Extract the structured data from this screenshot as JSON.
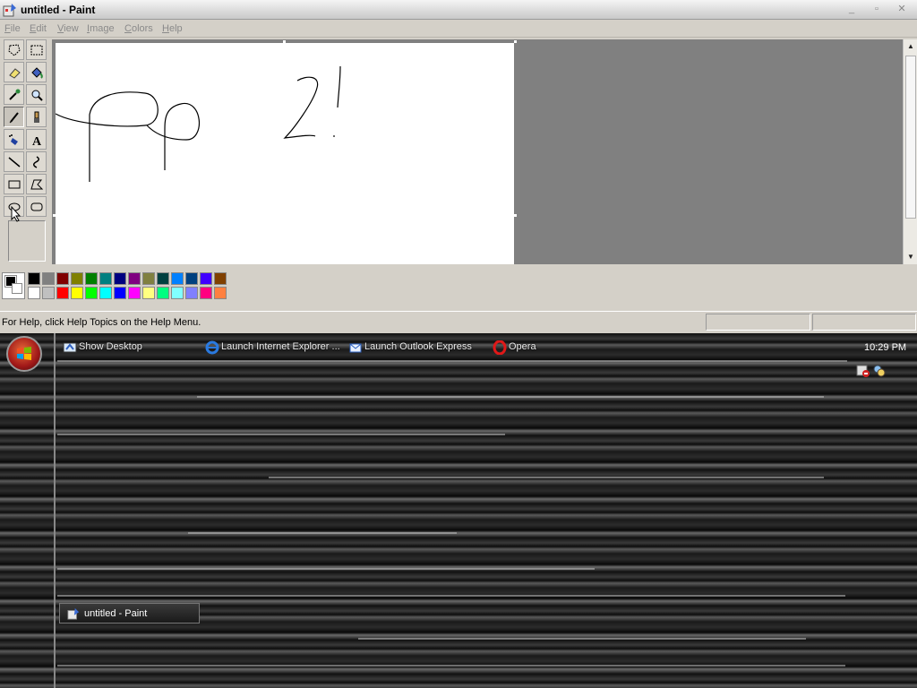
{
  "window": {
    "title": "untitled - Paint",
    "controls": {
      "minimize": "_",
      "maximize": "▫",
      "close": "✕"
    }
  },
  "menu": [
    {
      "first": "F",
      "rest": "ile"
    },
    {
      "first": "E",
      "rest": "dit"
    },
    {
      "first": "V",
      "rest": "iew"
    },
    {
      "first": "I",
      "rest": "mage"
    },
    {
      "first": "C",
      "rest": "olors"
    },
    {
      "first": "H",
      "rest": "elp"
    }
  ],
  "tools": [
    "free-form-select",
    "select",
    "eraser",
    "fill-with-color",
    "pick-color",
    "magnifier",
    "pencil",
    "brush",
    "airbrush",
    "text",
    "line",
    "curve",
    "rectangle",
    "polygon",
    "ellipse",
    "rounded-rectangle"
  ],
  "active_tool": "pencil",
  "palette": {
    "foreground": "#000000",
    "background": "#ffffff",
    "row1": [
      "#000000",
      "#808080",
      "#800000",
      "#808000",
      "#008000",
      "#008080",
      "#000080",
      "#800080",
      "#808040",
      "#004040",
      "#0080ff",
      "#004080",
      "#4000ff",
      "#804000"
    ],
    "row2": [
      "#ffffff",
      "#c0c0c0",
      "#ff0000",
      "#ffff00",
      "#00ff00",
      "#00ffff",
      "#0000ff",
      "#ff00ff",
      "#ffff80",
      "#00ff80",
      "#80ffff",
      "#8080ff",
      "#ff0080",
      "#ff8040"
    ]
  },
  "status": {
    "help_text": "For Help, click Help Topics on the Help Menu."
  },
  "taskbar": {
    "quick_launch": [
      {
        "label": "Show Desktop",
        "icon": "show-desktop-icon"
      },
      {
        "label": "Launch Internet Explorer ...",
        "icon": "internet-explorer-icon"
      },
      {
        "label": "Launch Outlook Express",
        "icon": "outlook-express-icon"
      },
      {
        "label": "Opera",
        "icon": "opera-icon"
      }
    ],
    "clock": "10:29 PM",
    "task_button": "untitled - Paint"
  }
}
